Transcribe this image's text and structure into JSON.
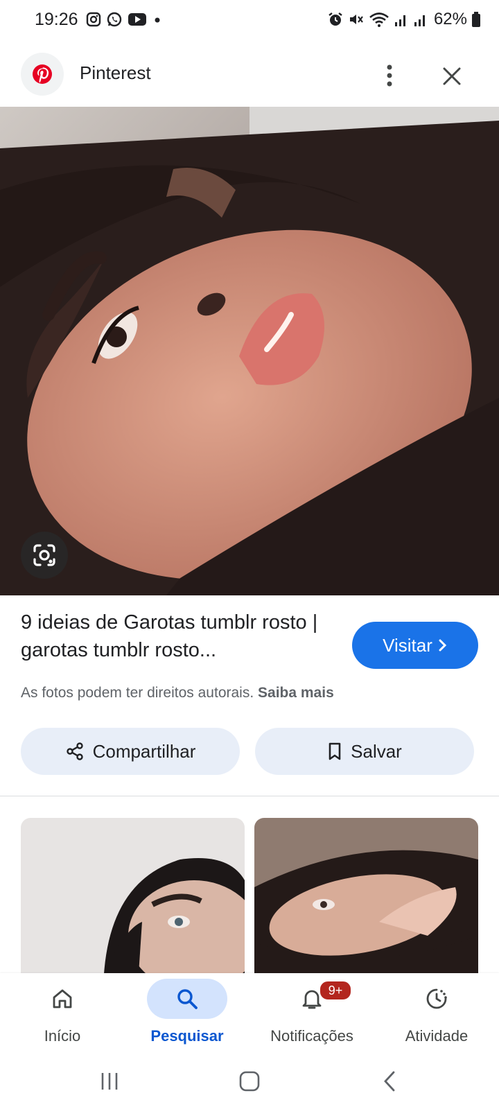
{
  "status_bar": {
    "time": "19:26",
    "battery": "62%",
    "icons": [
      "instagram-icon",
      "whatsapp-icon",
      "youtube-icon",
      "dot-icon",
      "alarm-icon",
      "mute-icon",
      "wifi-icon",
      "signal-icon",
      "signal-icon",
      "battery-icon"
    ]
  },
  "header": {
    "site_name": "Pinterest",
    "logo_icon": "pinterest-logo",
    "more_icon": "more-vert-icon",
    "close_icon": "close-icon"
  },
  "result": {
    "title": "9 ideias de Garotas tumblr rosto | garotas tumblr rosto...",
    "visit_label": "Visitar",
    "copyright_text": "As fotos podem ter direitos autorais.",
    "learn_more": "Saiba mais",
    "share_label": "Compartilhar",
    "save_label": "Salvar"
  },
  "bottom_nav": {
    "items": [
      {
        "label": "Início",
        "icon": "home-icon"
      },
      {
        "label": "Pesquisar",
        "icon": "search-icon",
        "active": true
      },
      {
        "label": "Notificações",
        "icon": "bell-icon",
        "badge": "9+"
      },
      {
        "label": "Atividade",
        "icon": "activity-icon"
      }
    ]
  },
  "colors": {
    "accent": "#1a73e8",
    "active_nav": "#0b57d0",
    "badge": "#b3261e",
    "pinterest_red": "#e60023"
  }
}
